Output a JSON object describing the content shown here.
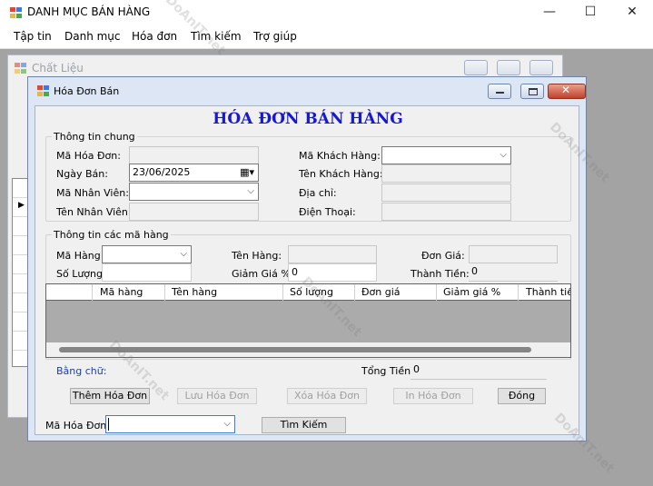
{
  "main": {
    "title": "DANH MỤC BÁN HÀNG",
    "menu": [
      "Tập tin",
      "Danh mục",
      "Hóa đơn",
      "Tìm kiếm",
      "Trợ giúp"
    ]
  },
  "back_window": {
    "title": "Chất Liệu"
  },
  "dialog": {
    "title": "Hóa Đơn Bán",
    "heading": "HÓA ĐƠN BÁN HÀNG",
    "general": {
      "legend": "Thông tin chung",
      "invoice_id_label": "Mã Hóa Đơn:",
      "invoice_id_value": "",
      "sale_date_label": "Ngày Bán:",
      "sale_date_value": "23/06/2025",
      "employee_id_label": "Mã Nhân Viên:",
      "employee_id_value": "",
      "employee_name_label": "Tên Nhân Viên:",
      "employee_name_value": "",
      "customer_id_label": "Mã Khách Hàng:",
      "customer_id_value": "",
      "customer_name_label": "Tên Khách Hàng:",
      "customer_name_value": "",
      "address_label": "Địa chỉ:",
      "address_value": "",
      "phone_label": "Điện Thoại:",
      "phone_value": ""
    },
    "items": {
      "legend": "Thông tin các mã hàng",
      "item_id_label": "Mã Hàng:",
      "item_name_label": "Tên Hàng:",
      "unit_price_label": "Đơn Giá:",
      "quantity_label": "Số Lượng:",
      "discount_label": "Giảm Giá %:",
      "discount_value": "0",
      "line_total_label": "Thành Tiền:",
      "line_total_value": "0"
    },
    "grid_columns": [
      "Mã hàng",
      "Tên hàng",
      "Số lượng",
      "Đơn giá",
      "Giảm giá %",
      "Thành tiền"
    ],
    "in_words_label": "Bằng chữ:",
    "grand_total_label": "Tổng Tiền:",
    "grand_total_value": "0",
    "buttons": {
      "add": "Thêm Hóa Đơn",
      "save": "Lưu Hóa Đơn",
      "delete": "Xóa Hóa Đơn",
      "print": "In Hóa Đơn",
      "close": "Đóng"
    },
    "search_label": "Mã Hóa Đơn:",
    "search_value": "",
    "search_button": "Tìm Kiếm"
  },
  "watermark": "DoAnIT.net",
  "colors": {
    "heading": "#1818d0",
    "link_label": "#1e3fa8",
    "mdi_background": "#a3a3a3"
  }
}
